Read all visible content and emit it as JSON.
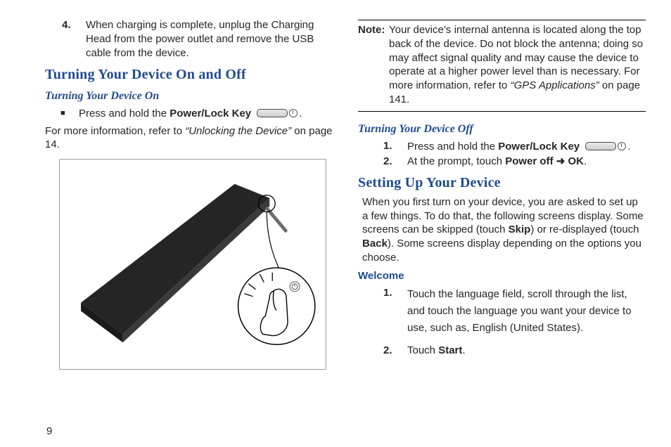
{
  "page_number": "9",
  "left": {
    "item4": {
      "num": "4.",
      "text": "When charging is complete, unplug the Charging Head from the power outlet and remove the USB cable from the device."
    },
    "h2_power": "Turning Your Device On and Off",
    "h3_on": "Turning Your Device On",
    "bullet_on": {
      "pre": "Press and hold the ",
      "key": "Power/Lock Key",
      "post": "."
    },
    "more_info": {
      "pre": "For more information, refer to ",
      "link": "“Unlocking the Device”",
      "post": " on page 14."
    }
  },
  "right": {
    "note": {
      "label": "Note:",
      "text_pre": "Your device’s internal antenna is located along the top back of the device. Do not block the antenna; doing so may affect signal quality and may cause the device to operate at a higher power level than is necessary. For more information, refer to ",
      "link": "“GPS Applications”",
      "text_post": " on page 141."
    },
    "h3_off": "Turning Your Device Off",
    "off1": {
      "num": "1.",
      "pre": "Press and hold the ",
      "key": "Power/Lock Key",
      "post": "."
    },
    "off2": {
      "num": "2.",
      "pre": "At the prompt, touch ",
      "b1": "Power off",
      "arrow": " ➜ ",
      "b2": "OK",
      "post": "."
    },
    "h2_setup": "Setting Up Your Device",
    "setup_para": {
      "p1": "When you first turn on your device, you are asked to set up a few things. To do that, the following screens display. Some screens can be skipped (touch ",
      "b1": "Skip",
      "p2": ") or re-displayed (touch ",
      "b2": "Back",
      "p3": "). Some screens display depending on the options you choose."
    },
    "h3_welcome": "Welcome",
    "welcome1": {
      "num": "1.",
      "text": "Touch the language field, scroll through the list, and touch the language you want your device to use, such as, English (United States)."
    },
    "welcome2": {
      "num": "2.",
      "pre": "Touch ",
      "b": "Start",
      "post": "."
    }
  },
  "icons": {
    "power_key": "power-lock-key-icon"
  }
}
